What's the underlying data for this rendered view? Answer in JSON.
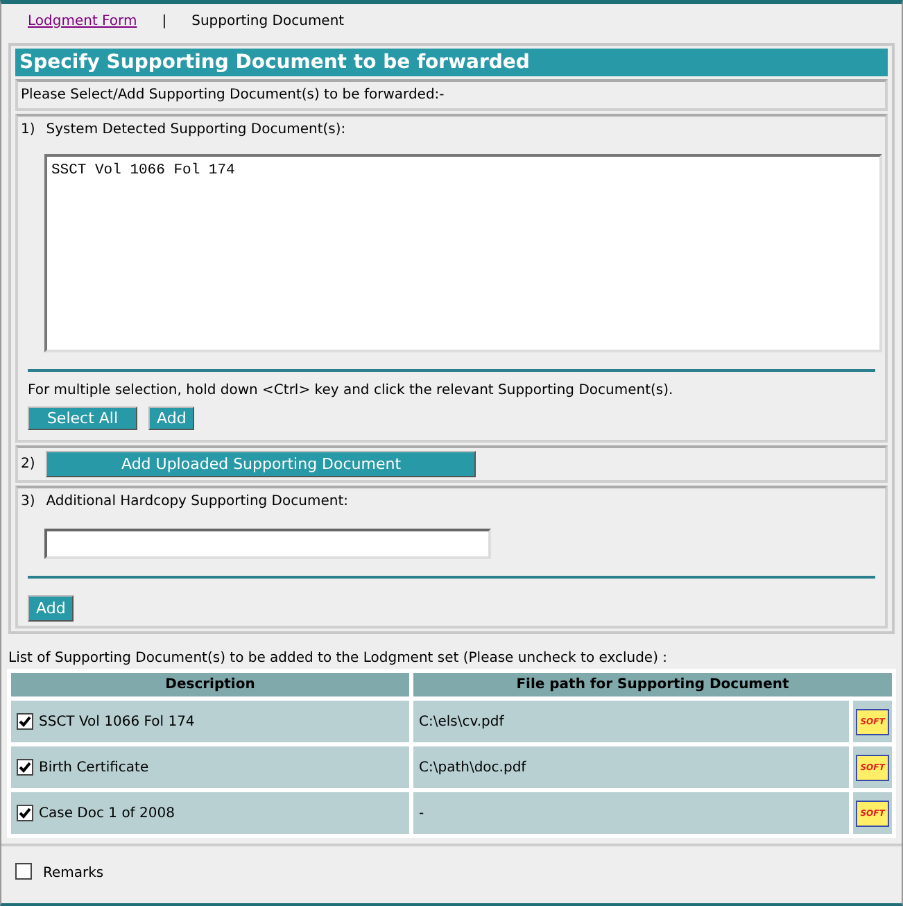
{
  "nav": {
    "separator": "|",
    "items": [
      {
        "label": "Lodgment Form",
        "selected": false
      },
      {
        "label": "Supporting Document",
        "selected": true
      }
    ]
  },
  "title": "Specify Supporting Document to be forwarded",
  "instruction": "Please Select/Add Supporting Document(s) to be forwarded:-",
  "section_1": {
    "number": "1)",
    "label": "System Detected Supporting Document(s):",
    "listbox_items": [
      {
        "label": "SSCT Vol 1066 Fol 174",
        "selected": false
      }
    ],
    "hint": "For multiple selection, hold down <Ctrl> key and click the relevant Supporting Document(s).",
    "buttons": [
      "Select All",
      "Add"
    ]
  },
  "section_2": {
    "number": "2)",
    "button": "Add Uploaded Supporting Document"
  },
  "section_3": {
    "number": "3)",
    "label": "Additional Hardcopy Supporting Document:",
    "button": "Add"
  },
  "list_caption": "List of Supporting Document(s) to be added to the Lodgment set (Please uncheck to exclude) :",
  "table": {
    "columns": [
      "Description",
      "File path for Supporting Document"
    ],
    "rows": [
      {
        "checked": true,
        "description": "SSCT Vol 1066 Fol 174",
        "file_path": "C:\\els\\cv.pdf",
        "icon_label": "SOFT"
      },
      {
        "checked": true,
        "description": "Birth Certificate",
        "file_path": "C:\\path\\doc.pdf",
        "icon_label": "SOFT"
      },
      {
        "checked": true,
        "description": "Case Doc 1 of 2008",
        "file_path": "-",
        "icon_label": "SOFT"
      }
    ]
  },
  "remarks": {
    "label": "Remarks",
    "checked": false
  }
}
